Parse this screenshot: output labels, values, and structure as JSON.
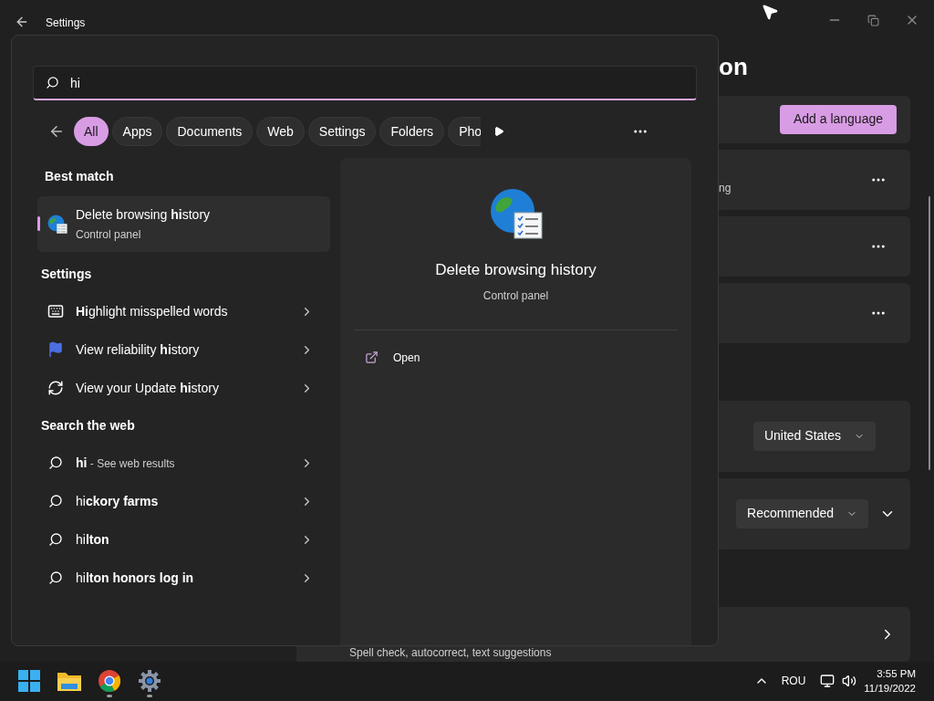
{
  "window": {
    "title": "Settings"
  },
  "page": {
    "heading": "on",
    "groups": [
      [
        {
          "kind": "button",
          "text": "Add a language"
        },
        {
          "kind": "menu",
          "text": "ng"
        },
        {
          "kind": "menu"
        },
        {
          "kind": "menu"
        }
      ],
      [
        {
          "kind": "dropdown",
          "value": "United States",
          "expandable": false
        },
        {
          "kind": "dropdown",
          "value": "Recommended",
          "expandable": true
        }
      ],
      [
        {
          "kind": "link",
          "text": "Spell check, autocorrect, text suggestions"
        }
      ]
    ]
  },
  "search": {
    "query": "hi",
    "filters": [
      {
        "label": "All",
        "selected": true
      },
      {
        "label": "Apps",
        "selected": false
      },
      {
        "label": "Documents",
        "selected": false
      },
      {
        "label": "Web",
        "selected": false
      },
      {
        "label": "Settings",
        "selected": false
      },
      {
        "label": "Folders",
        "selected": false
      },
      {
        "label": "Pho",
        "selected": false
      }
    ],
    "best_match": {
      "heading": "Best match",
      "title": "Delete browsing **hi**story",
      "subtitle": "Control panel",
      "selected": true
    },
    "sections": [
      {
        "heading": "Settings",
        "items": [
          {
            "kind": "keyboard",
            "text": "**Hi**ghlight misspelled words"
          },
          {
            "kind": "flag",
            "text": "View reliability **hi**story"
          },
          {
            "kind": "refresh",
            "text": "View your Update **hi**story"
          }
        ]
      },
      {
        "heading": "Search the web",
        "items": [
          {
            "kind": "web",
            "text": "**hi**",
            "suffix": "- See web results"
          },
          {
            "kind": "web",
            "text": "hi**ckory farms**"
          },
          {
            "kind": "web",
            "text": "hi**lton**"
          },
          {
            "kind": "web",
            "text": "hi**lton honors log in**"
          }
        ]
      }
    ],
    "preview": {
      "title": "Delete browsing history",
      "subtitle": "Control panel",
      "actions": [
        "Open"
      ]
    }
  },
  "taskbar": {
    "apps": [
      {
        "kind": "start",
        "running": false
      },
      {
        "kind": "explorer",
        "running": false
      },
      {
        "kind": "chrome",
        "running": true
      },
      {
        "kind": "settings",
        "running": true
      }
    ],
    "language": "ROU",
    "time": "3:55 PM",
    "date": "11/19/2022"
  }
}
